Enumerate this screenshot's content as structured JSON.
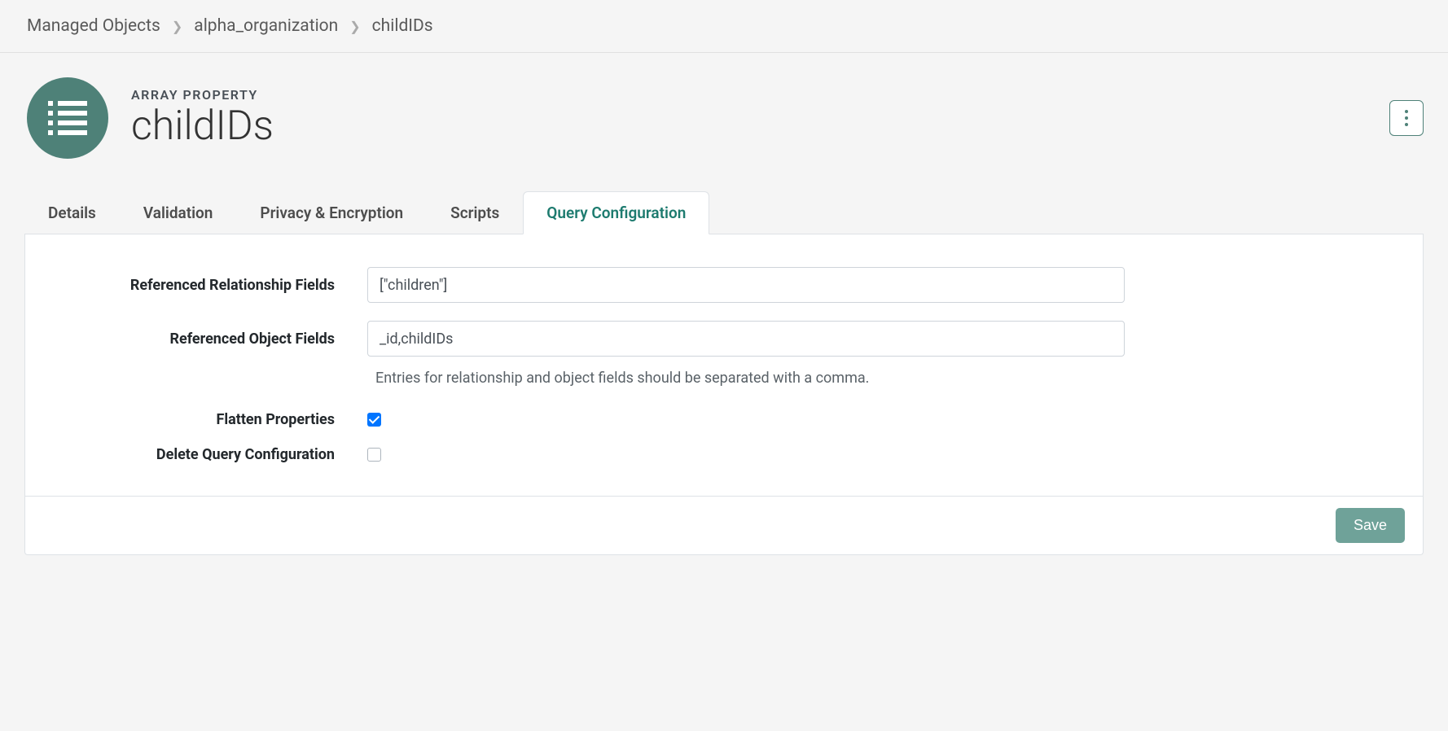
{
  "breadcrumb": {
    "items": [
      "Managed Objects",
      "alpha_organization",
      "childIDs"
    ]
  },
  "header": {
    "subtitle": "ARRAY PROPERTY",
    "title": "childIDs"
  },
  "tabs": {
    "items": [
      {
        "label": "Details",
        "active": false
      },
      {
        "label": "Validation",
        "active": false
      },
      {
        "label": "Privacy & Encryption",
        "active": false
      },
      {
        "label": "Scripts",
        "active": false
      },
      {
        "label": "Query Configuration",
        "active": true
      }
    ]
  },
  "form": {
    "relationship_label": "Referenced Relationship Fields",
    "relationship_value": "[\"children\"]",
    "object_label": "Referenced Object Fields",
    "object_value": "_id,childIDs",
    "help_text": "Entries for relationship and object fields should be separated with a comma.",
    "flatten_label": "Flatten Properties",
    "flatten_checked": true,
    "delete_label": "Delete Query Configuration",
    "delete_checked": false
  },
  "actions": {
    "save_label": "Save"
  }
}
